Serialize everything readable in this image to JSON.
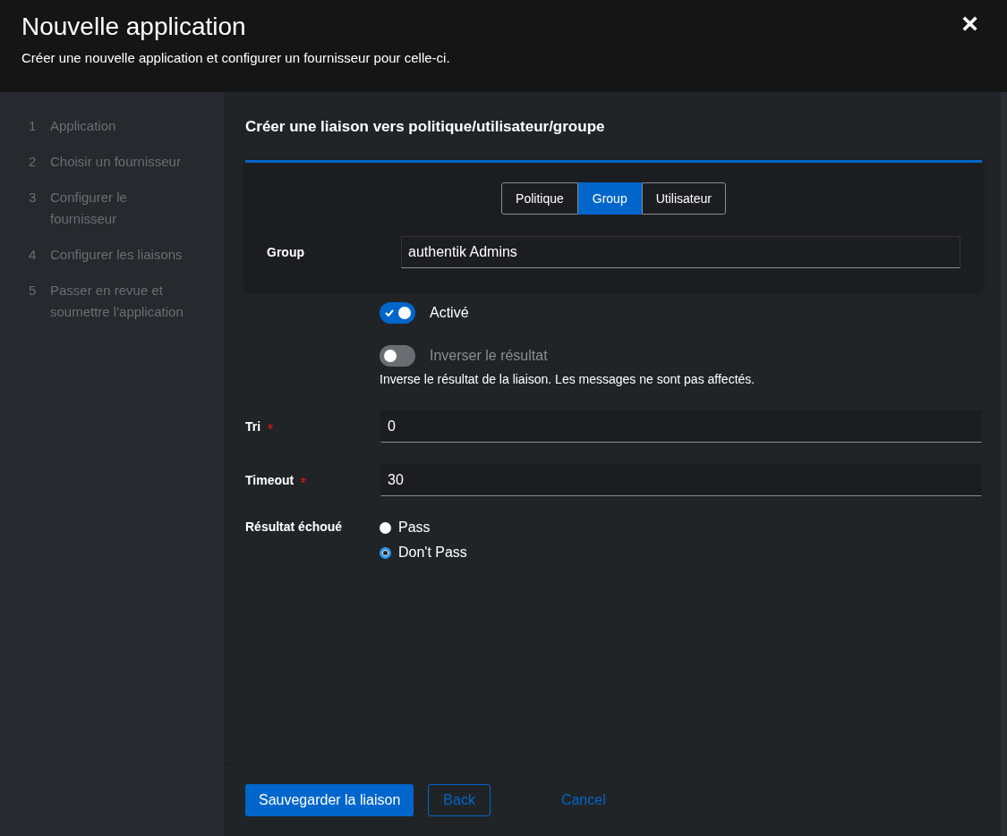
{
  "header": {
    "title": "Nouvelle application",
    "subtitle": "Créer une nouvelle application et configurer un fournisseur pour celle-ci.",
    "close": "×"
  },
  "steps": [
    {
      "number": "1",
      "label": "Application",
      "disabled": true
    },
    {
      "number": "2",
      "label": "Choisir un fournisseur",
      "disabled": true
    },
    {
      "number": "3",
      "label": "Configurer le fournisseur",
      "disabled": true
    },
    {
      "number": "4",
      "label": "Configurer les liaisons",
      "disabled": true
    },
    {
      "number": "5",
      "label": "Passer en revue et soumettre l'application",
      "disabled": true
    }
  ],
  "form": {
    "title": "Créer une liaison vers politique/utilisateur/groupe",
    "tabs": [
      {
        "label": "Politique",
        "selected": false
      },
      {
        "label": "Group",
        "selected": true
      },
      {
        "label": "Utilisateur",
        "selected": false
      }
    ],
    "group": {
      "label": "Group",
      "value": "authentik Admins"
    },
    "switches": [
      {
        "label": "Activé",
        "on": true,
        "disabled": false
      },
      {
        "label": "Inverser le résultat",
        "on": false,
        "disabled": true,
        "help": "Inverse le résultat de la liaison. Les messages ne sont pas affectés."
      }
    ],
    "fields": [
      {
        "label": "Tri",
        "required": true,
        "value": "0"
      },
      {
        "label": "Timeout",
        "required": true,
        "value": "30"
      }
    ],
    "failure": {
      "label": "Résultat échoué",
      "options": [
        {
          "label": "Pass",
          "selected": false
        },
        {
          "label": "Don't Pass",
          "selected": true
        }
      ]
    }
  },
  "footer": {
    "primary": "Sauvegarder la liaison",
    "secondary": "Back",
    "link": "Cancel"
  }
}
